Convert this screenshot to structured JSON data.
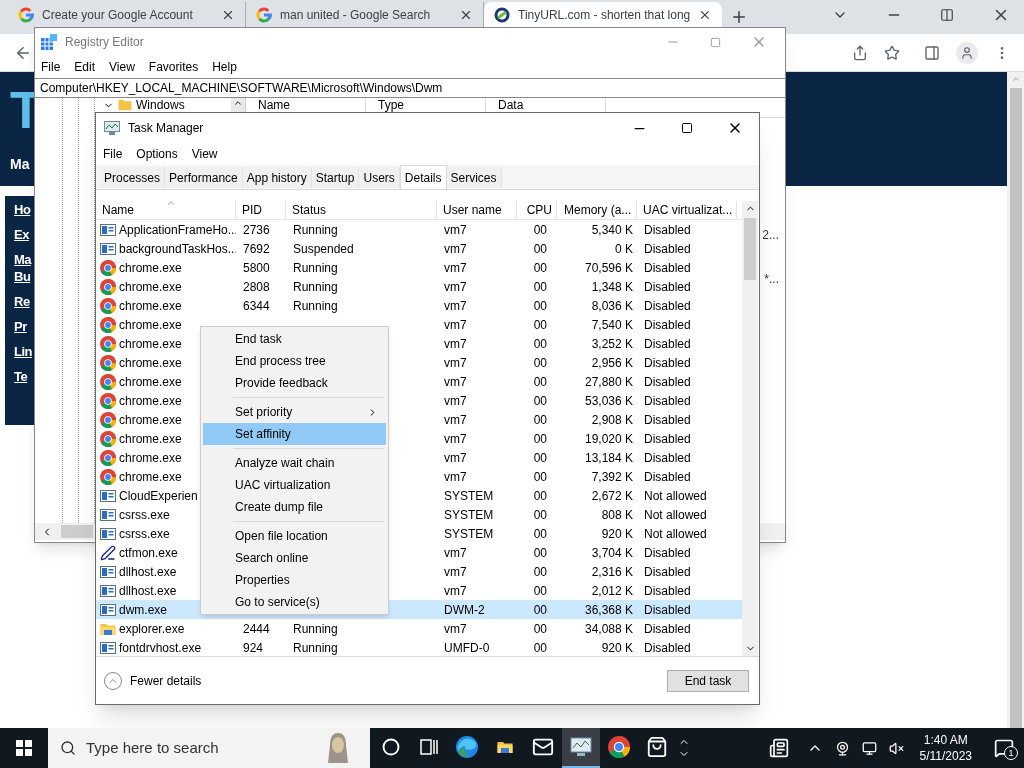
{
  "browser": {
    "tabs": [
      {
        "title": "Create your Google Account",
        "kind": "google",
        "selected": false
      },
      {
        "title": "man united - Google Search",
        "kind": "google",
        "selected": false
      },
      {
        "title": "TinyURL.com - shorten that long",
        "kind": "tinyurl",
        "selected": true
      }
    ],
    "page": {
      "logo": "T",
      "tagline": "Ma",
      "nav_links": [
        [
          "Ho"
        ],
        [
          "Ex"
        ],
        [
          "Ma",
          "Bu"
        ],
        [
          "Re"
        ],
        [
          "Pr"
        ],
        [
          "Lin"
        ],
        [
          "Te"
        ]
      ]
    }
  },
  "registry_editor": {
    "title": "Registry Editor",
    "menu": [
      "File",
      "Edit",
      "View",
      "Favorites",
      "Help"
    ],
    "address": "Computer\\HKEY_LOCAL_MACHINE\\SOFTWARE\\Microsoft\\Windows\\Dwm",
    "tree_item": "Windows",
    "columns": [
      "Name",
      "Type",
      "Data"
    ],
    "data_fragments": [
      "2...",
      "*..."
    ]
  },
  "task_manager": {
    "title": "Task Manager",
    "menu": [
      "File",
      "Options",
      "View"
    ],
    "tabs": [
      {
        "label": "Processes",
        "selected": false
      },
      {
        "label": "Performance",
        "selected": false
      },
      {
        "label": "App history",
        "selected": false
      },
      {
        "label": "Startup",
        "selected": false
      },
      {
        "label": "Users",
        "selected": false
      },
      {
        "label": "Details",
        "selected": true
      },
      {
        "label": "Services",
        "selected": false
      }
    ],
    "columns": [
      {
        "label": "Name",
        "sorted": true
      },
      {
        "label": "PID",
        "sorted": false
      },
      {
        "label": "Status",
        "sorted": false
      },
      {
        "label": "User name",
        "sorted": false
      },
      {
        "label": "CPU",
        "sorted": false
      },
      {
        "label": "Memory (a...",
        "sorted": false
      },
      {
        "label": "UAC virtualizat...",
        "sorted": false
      }
    ],
    "rows": [
      {
        "kind": "app",
        "name": "ApplicationFrameHo...",
        "pid": "2736",
        "status": "Running",
        "user": "vm7",
        "cpu": "00",
        "memory": "5,340 K",
        "uac": "Disabled",
        "selected": false
      },
      {
        "kind": "app",
        "name": "backgroundTaskHos...",
        "pid": "7692",
        "status": "Suspended",
        "user": "vm7",
        "cpu": "00",
        "memory": "0 K",
        "uac": "Disabled",
        "selected": false
      },
      {
        "kind": "chrome",
        "name": "chrome.exe",
        "pid": "5800",
        "status": "Running",
        "user": "vm7",
        "cpu": "00",
        "memory": "70,596 K",
        "uac": "Disabled",
        "selected": false
      },
      {
        "kind": "chrome",
        "name": "chrome.exe",
        "pid": "2808",
        "status": "Running",
        "user": "vm7",
        "cpu": "00",
        "memory": "1,348 K",
        "uac": "Disabled",
        "selected": false
      },
      {
        "kind": "chrome",
        "name": "chrome.exe",
        "pid": "6344",
        "status": "Running",
        "user": "vm7",
        "cpu": "00",
        "memory": "8,036 K",
        "uac": "Disabled",
        "selected": false
      },
      {
        "kind": "chrome",
        "name": "chrome.exe",
        "user": "vm7",
        "cpu": "00",
        "memory": "7,540 K",
        "uac": "Disabled",
        "selected": false
      },
      {
        "kind": "chrome",
        "name": "chrome.exe",
        "user": "vm7",
        "cpu": "00",
        "memory": "3,252 K",
        "uac": "Disabled",
        "selected": false
      },
      {
        "kind": "chrome",
        "name": "chrome.exe",
        "user": "vm7",
        "cpu": "00",
        "memory": "2,956 K",
        "uac": "Disabled",
        "selected": false
      },
      {
        "kind": "chrome",
        "name": "chrome.exe",
        "user": "vm7",
        "cpu": "00",
        "memory": "27,880 K",
        "uac": "Disabled",
        "selected": false
      },
      {
        "kind": "chrome",
        "name": "chrome.exe",
        "user": "vm7",
        "cpu": "00",
        "memory": "53,036 K",
        "uac": "Disabled",
        "selected": false
      },
      {
        "kind": "chrome",
        "name": "chrome.exe",
        "user": "vm7",
        "cpu": "00",
        "memory": "2,908 K",
        "uac": "Disabled",
        "selected": false
      },
      {
        "kind": "chrome",
        "name": "chrome.exe",
        "user": "vm7",
        "cpu": "00",
        "memory": "19,020 K",
        "uac": "Disabled",
        "selected": false
      },
      {
        "kind": "chrome",
        "name": "chrome.exe",
        "user": "vm7",
        "cpu": "00",
        "memory": "13,184 K",
        "uac": "Disabled",
        "selected": false
      },
      {
        "kind": "chrome",
        "name": "chrome.exe",
        "user": "vm7",
        "cpu": "00",
        "memory": "7,392 K",
        "uac": "Disabled",
        "selected": false
      },
      {
        "kind": "app",
        "name": "CloudExperien",
        "user": "SYSTEM",
        "cpu": "00",
        "memory": "2,672 K",
        "uac": "Not allowed",
        "selected": false
      },
      {
        "kind": "app",
        "name": "csrss.exe",
        "user": "SYSTEM",
        "cpu": "00",
        "memory": "808 K",
        "uac": "Not allowed",
        "selected": false
      },
      {
        "kind": "app",
        "name": "csrss.exe",
        "user": "SYSTEM",
        "cpu": "00",
        "memory": "920 K",
        "uac": "Not allowed",
        "selected": false
      },
      {
        "kind": "pen",
        "name": "ctfmon.exe",
        "user": "vm7",
        "cpu": "00",
        "memory": "3,704 K",
        "uac": "Disabled",
        "selected": false
      },
      {
        "kind": "app",
        "name": "dllhost.exe",
        "user": "vm7",
        "cpu": "00",
        "memory": "2,316 K",
        "uac": "Disabled",
        "selected": false
      },
      {
        "kind": "app",
        "name": "dllhost.exe",
        "user": "vm7",
        "cpu": "00",
        "memory": "2,012 K",
        "uac": "Disabled",
        "selected": false
      },
      {
        "kind": "app",
        "name": "dwm.exe",
        "user": "DWM-2",
        "cpu": "00",
        "memory": "36,368 K",
        "uac": "Disabled",
        "selected": true
      },
      {
        "kind": "folder",
        "name": "explorer.exe",
        "pid": "2444",
        "status": "Running",
        "user": "vm7",
        "cpu": "00",
        "memory": "34,088 K",
        "uac": "Disabled",
        "selected": false
      },
      {
        "kind": "app",
        "name": "fontdrvhost.exe",
        "pid": "924",
        "status": "Running",
        "user": "UMFD-0",
        "cpu": "00",
        "memory": "920 K",
        "uac": "Disabled",
        "selected": false
      }
    ],
    "fewer_details": "Fewer details",
    "end_task_button": "End task"
  },
  "context_menu": {
    "items": [
      {
        "kind": "item",
        "label": "End task",
        "submenu": false,
        "selected": false
      },
      {
        "kind": "item",
        "label": "End process tree",
        "submenu": false,
        "selected": false
      },
      {
        "kind": "item",
        "label": "Provide feedback",
        "submenu": false,
        "selected": false
      },
      {
        "kind": "separator"
      },
      {
        "kind": "item",
        "label": "Set priority",
        "submenu": true,
        "selected": false
      },
      {
        "kind": "item",
        "label": "Set affinity",
        "submenu": false,
        "selected": true
      },
      {
        "kind": "separator"
      },
      {
        "kind": "item",
        "label": "Analyze wait chain",
        "submenu": false,
        "selected": false
      },
      {
        "kind": "item",
        "label": "UAC virtualization",
        "submenu": false,
        "selected": false
      },
      {
        "kind": "item",
        "label": "Create dump file",
        "submenu": false,
        "selected": false
      },
      {
        "kind": "separator"
      },
      {
        "kind": "item",
        "label": "Open file location",
        "submenu": false,
        "selected": false
      },
      {
        "kind": "item",
        "label": "Search online",
        "submenu": false,
        "selected": false
      },
      {
        "kind": "item",
        "label": "Properties",
        "submenu": false,
        "selected": false
      },
      {
        "kind": "item",
        "label": "Go to service(s)",
        "submenu": false,
        "selected": false
      }
    ]
  },
  "taskbar": {
    "search_placeholder": "Type here to search",
    "apps": [
      {
        "kind": "cortana",
        "active": false
      },
      {
        "kind": "taskview",
        "active": false
      },
      {
        "kind": "edge",
        "active": false
      },
      {
        "kind": "explorer",
        "active": false
      },
      {
        "kind": "mail",
        "active": false
      },
      {
        "kind": "taskmanager",
        "active": true
      },
      {
        "kind": "chrome",
        "active": false
      },
      {
        "kind": "store",
        "active": false
      }
    ],
    "time": "1:40 AM",
    "date": "5/11/2023",
    "notifications": "1"
  }
}
